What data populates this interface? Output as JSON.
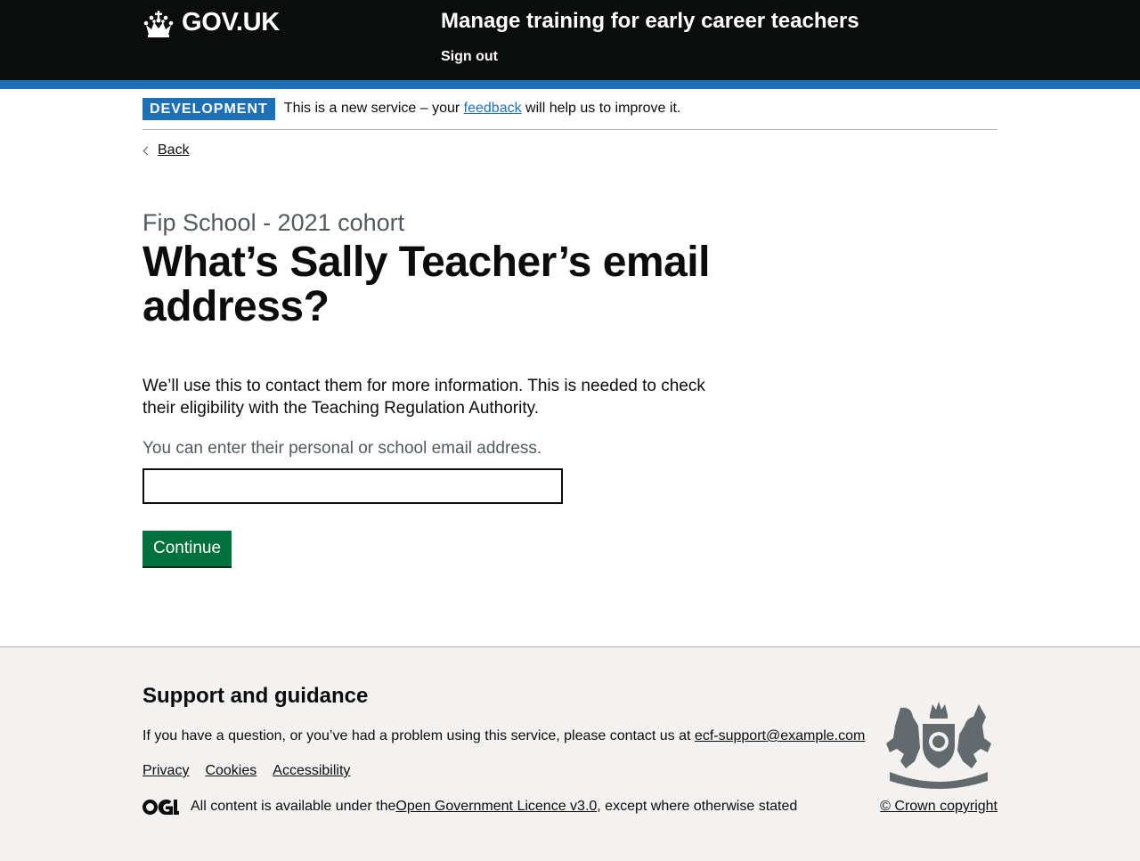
{
  "header": {
    "logo_text": "GOV.UK",
    "service_name": "Manage training for early career teachers",
    "sign_out": "Sign out"
  },
  "phase_banner": {
    "tag": "DEVELOPMENT",
    "text_before": "This is a new service – your ",
    "link": "feedback",
    "text_after": " will help us to improve it."
  },
  "back_link": "Back",
  "main": {
    "caption": "Fip School - 2021 cohort",
    "heading": "What’s Sally Teacher’s email address?",
    "body": "We’ll use this to contact them for more information. This is needed to check their eligibility with the Teaching Regulation Authority.",
    "hint": "You can enter their personal or school email address.",
    "email_value": "",
    "continue_label": "Continue"
  },
  "footer": {
    "heading": "Support and guidance",
    "contact_text": "If you have a question, or you’ve had a problem using this service, please contact us at ",
    "contact_email": "ecf-support@example.com",
    "links": [
      "Privacy",
      "Cookies",
      "Accessibility"
    ],
    "licence_before": "All content is available under the ",
    "licence_link": "Open Government Licence v3.0",
    "licence_after": ", except where otherwise stated",
    "copyright": "© Crown copyright"
  },
  "colors": {
    "header_bg": "#0b0c0c",
    "brand_blue": "#1d70b8",
    "button_green": "#00703c",
    "footer_bg": "#f3f2f1",
    "secondary_text": "#505a5f"
  },
  "icons": {
    "logo": "crown-icon",
    "ogl": "ogl-logo-icon",
    "crest": "royal-coat-of-arms-icon"
  }
}
